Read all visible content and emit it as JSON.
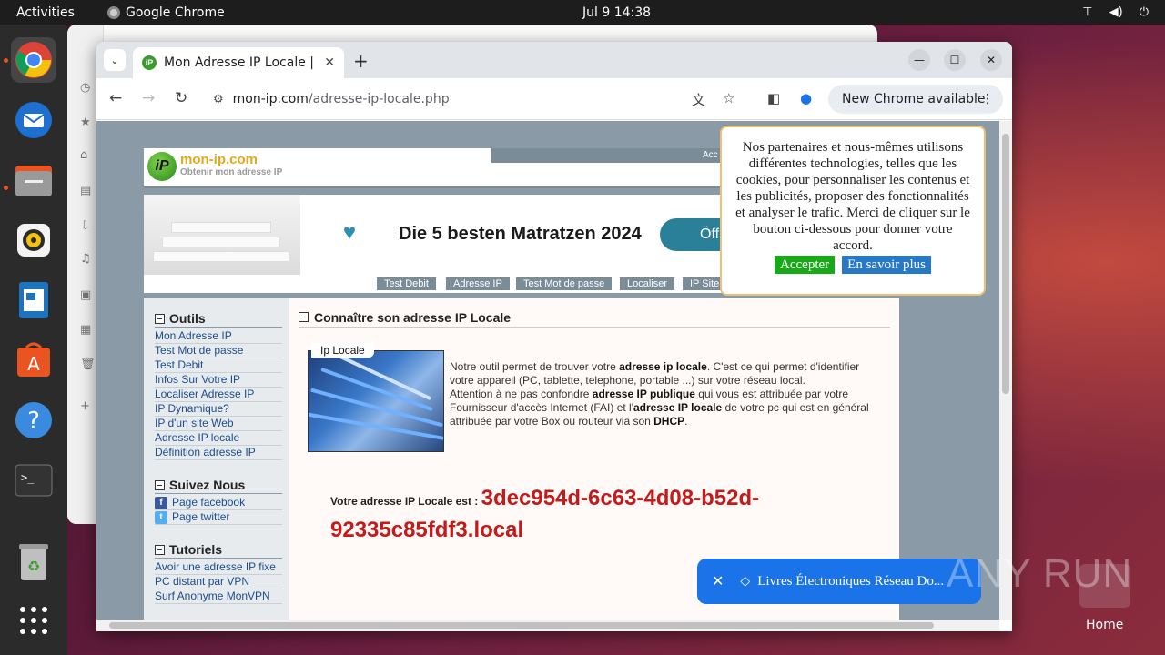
{
  "topbar": {
    "activities": "Activities",
    "app_name": "Google Chrome",
    "clock": "Jul 9  14:38"
  },
  "dock": {
    "items": [
      "chrome-icon",
      "thunderbird-icon",
      "files-icon",
      "rhythmbox-icon",
      "writer-icon",
      "app-center-icon",
      "help-icon",
      "terminal-icon",
      "trash-icon",
      "apps-grid-icon"
    ]
  },
  "desktop": {
    "home_label": "Home",
    "watermark": "ANY RUN"
  },
  "browser": {
    "tab_title": "Mon Adresse IP Locale | ",
    "tab_favicon": "iP",
    "url_domain": "mon-ip.com",
    "url_path": "/adresse-ip-locale.php",
    "update_label": "New Chrome available"
  },
  "site": {
    "logo_mark": "iP",
    "logo_name": "mon-ip.com",
    "logo_tagline": "Obtenir mon adresse IP",
    "header_link": "Acc",
    "ad_title": "Die 5 besten Matratzen 2024",
    "ad_button": "Öffn",
    "nav": [
      "Test Debit",
      "Adresse IP",
      "Test Mot de passe",
      "Localiser",
      "IP Site"
    ],
    "sidebar": {
      "tools_heading": "Outils",
      "tools": [
        "Mon Adresse IP",
        "Test Mot de passe",
        "Test Debit",
        "Infos Sur Votre IP",
        "Localiser Adresse IP",
        "IP Dynamique?",
        "IP d'un site Web",
        "Adresse IP locale",
        "Définition adresse IP"
      ],
      "follow_heading": "Suivez Nous",
      "follow": [
        "Page facebook",
        "Page twitter"
      ],
      "tutorials_heading": "Tutoriels",
      "tutorials": [
        "Avoir une adresse IP fixe",
        "PC distant par VPN",
        "Surf Anonyme MonVPN"
      ]
    },
    "main": {
      "heading": "Connaître son adresse IP Locale",
      "image_label": "Ip Locale",
      "desc_p1_a": "Notre outil permet de trouver votre ",
      "desc_p1_b": "adresse ip locale",
      "desc_p1_c": ". C'est ce qui permet d'identifier votre appareil (PC, tablette, telephone, portable ...) sur votre réseau local.",
      "desc_p2_a": "Attention à ne pas confondre ",
      "desc_p2_b": "adresse IP publique",
      "desc_p2_c": " qui vous est attribuée par votre Fournisseur d'accès Internet (FAI) et l'",
      "desc_p2_d": "adresse IP locale",
      "desc_p2_e": " de votre pc qui est en général attribuée par votre Box ou routeur via son ",
      "desc_p2_f": "DHCP",
      "desc_p2_g": ".",
      "result_label": "Votre adresse IP Locale est : ",
      "result_value": "3dec954d-6c63-4d08-b52d-92335c85fdf3.local"
    }
  },
  "cookie": {
    "text": "Nos partenaires et nous-mêmes utilisons différentes technologies, telles que les cookies, pour personnaliser les contenus et les publicités, proposer des fonctionnalités et analyser le trafic. Merci de cliquer sur le bouton ci-dessous pour donner votre accord.",
    "accept": "Accepter",
    "more": "En savoir plus"
  },
  "toast": {
    "text": "Livres Électroniques Réseau Do..."
  }
}
